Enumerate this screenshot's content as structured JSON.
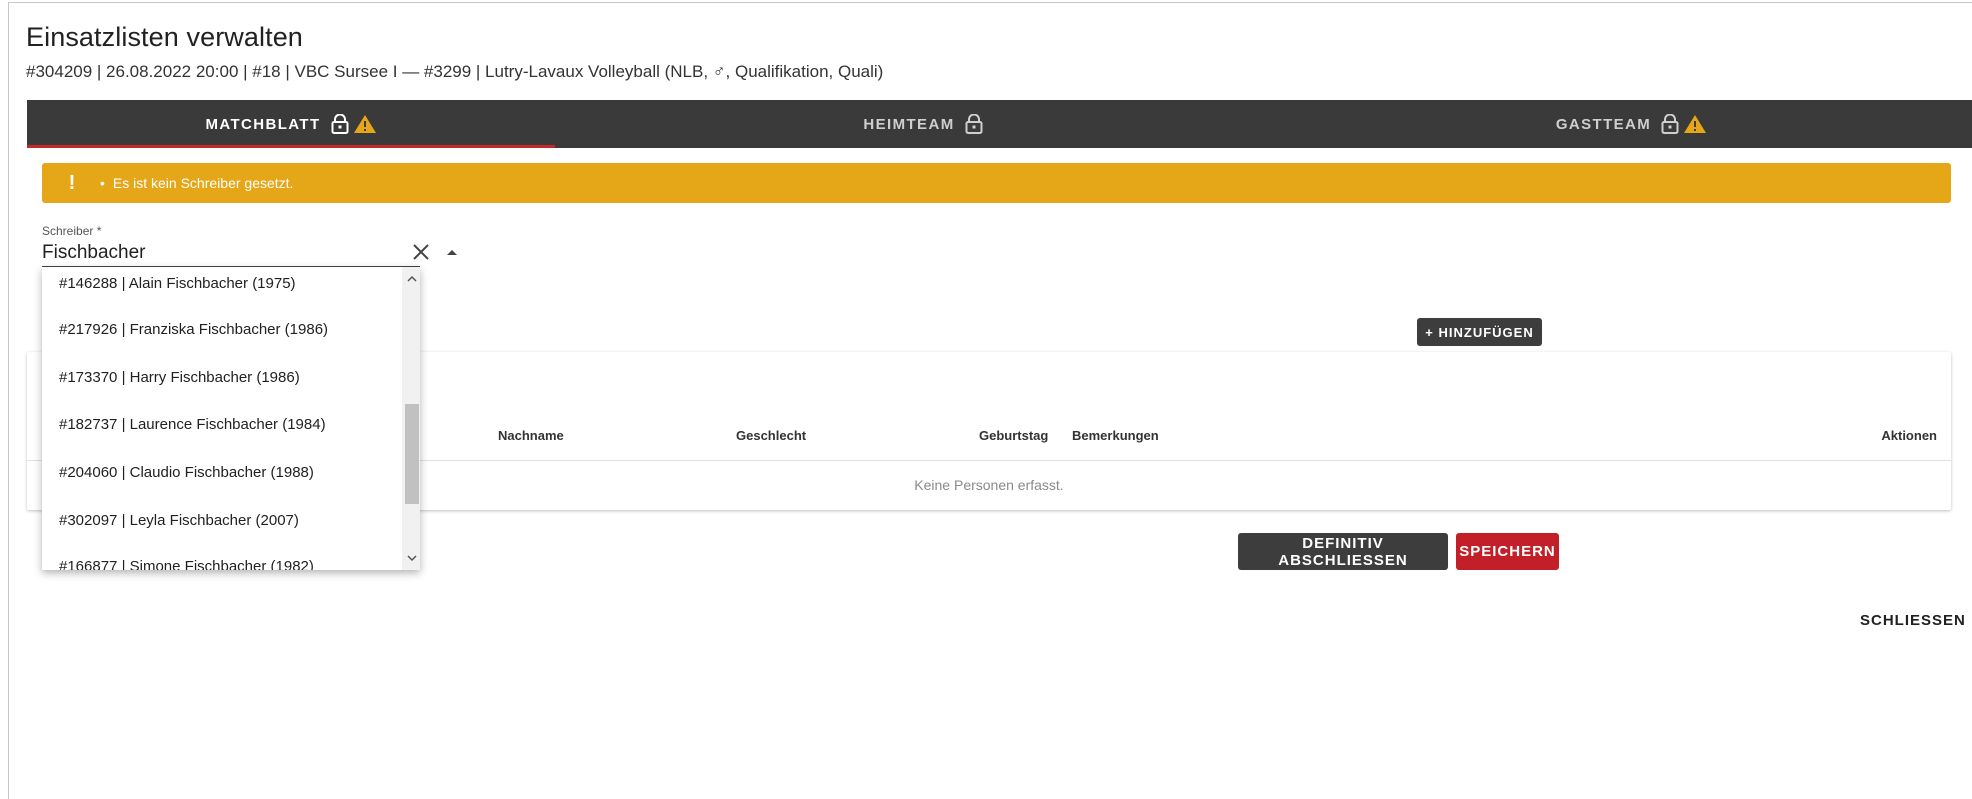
{
  "header": {
    "title": "Einsatzlisten verwalten",
    "subtitle": "#304209 | 26.08.2022 20:00 | #18 | VBC Sursee I — #3299 | Lutry-Lavaux Volleyball (NLB, ♂, Qualifikation, Quali)"
  },
  "tabs": [
    {
      "label": "MATCHBLATT",
      "locked": true,
      "warning": true,
      "active": true
    },
    {
      "label": "HEIMTEAM",
      "locked": true,
      "warning": false,
      "active": false
    },
    {
      "label": "GASTTEAM",
      "locked": true,
      "warning": true,
      "active": false
    }
  ],
  "alert": {
    "text": "Es ist kein Schreiber gesetzt.",
    "color": "#e5a617"
  },
  "schreiber": {
    "label": "Schreiber *",
    "value": "Fischbacher",
    "options": [
      "#146288 | Alain Fischbacher (1975)",
      "#217926 | Franziska Fischbacher (1986)",
      "#173370 | Harry Fischbacher (1986)",
      "#182737 | Laurence Fischbacher (1984)",
      "#204060 | Claudio Fischbacher (1988)",
      "#302097 | Leyla Fischbacher (2007)",
      "#166877 | Simone Fischbacher (1982)"
    ]
  },
  "table": {
    "columns": [
      "Nachname",
      "Geschlecht",
      "Geburtstag",
      "Bemerkungen",
      "Aktionen"
    ],
    "empty_text": "Keine Personen erfasst."
  },
  "buttons": {
    "add": "+ HINZUFÜGEN",
    "finalize": "DEFINITIV ABSCHLIESSEN",
    "save": "SPEICHERN",
    "close": "SCHLIESSEN"
  },
  "colors": {
    "tabbar": "#3a3a3a",
    "accent_red": "#c21f28",
    "warning": "#e5a617",
    "dark_button": "#3d3d3d"
  }
}
